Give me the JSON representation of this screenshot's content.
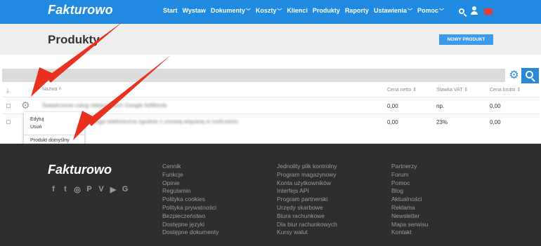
{
  "brand": {
    "name": "Fakturowo"
  },
  "nav": [
    {
      "label": "Start",
      "dropdown": false
    },
    {
      "label": "Wystaw",
      "dropdown": false
    },
    {
      "label": "Dokumenty",
      "dropdown": true
    },
    {
      "label": "Koszty",
      "dropdown": true
    },
    {
      "label": "Klienci",
      "dropdown": false
    },
    {
      "label": "Produkty",
      "dropdown": false
    },
    {
      "label": "Raporty",
      "dropdown": false
    },
    {
      "label": "Ustawienia",
      "dropdown": true
    },
    {
      "label": "Pomoc",
      "dropdown": true
    }
  ],
  "page": {
    "title": "Produkty",
    "new_button": "NOWY PRODUKT"
  },
  "table": {
    "columns": {
      "name": "Nazwa",
      "net": "Cena netto",
      "vat": "Stawka VAT",
      "gross": "Cena brutto"
    },
    "rows": [
      {
        "name": "Świadczenie usług reklamowych Google AdWords",
        "net": "0,00",
        "vat": "np.",
        "gross": "0,00"
      },
      {
        "name": "Usługa telefoniczna zgodnie z umową wiązaną w rozliczeniu",
        "net": "0,00",
        "vat": "23%",
        "gross": "0,00"
      }
    ]
  },
  "context_menu": {
    "edit": "Edytuj",
    "delete": "Usuń",
    "default": "Produkt domyślny"
  },
  "footer": {
    "logo": "Fakturowo",
    "social": [
      "f",
      "t",
      "◎",
      "P",
      "V",
      "▶",
      "G"
    ],
    "col1": [
      "Cennik",
      "Funkcje",
      "Opinie",
      "Regulamin",
      "Polityka cookies",
      "Polityka prywatności",
      "Bezpieczeństwo",
      "Dostępne języki",
      "Dostępne dokumenty"
    ],
    "col2": [
      "Jednolity plik kontrolny",
      "Program magazynowy",
      "Konta użytkowników",
      "Interfejs API",
      "Program partnerski",
      "Urzędy skarbowe",
      "Biura rachunkowe",
      "Dla biur rachunkowych",
      "Kursy walut"
    ],
    "col3": [
      "Partnerzy",
      "Forum",
      "Pomoc",
      "Blog",
      "Aktualności",
      "Reklama",
      "Newsletter",
      "Mapa serwisu",
      "Kontakt"
    ]
  },
  "colors": {
    "nav_bg": "#1f8ae0",
    "accent_button": "#3d9be9",
    "arrow": "#e8321f",
    "footer_bg": "#2e2e2e"
  }
}
